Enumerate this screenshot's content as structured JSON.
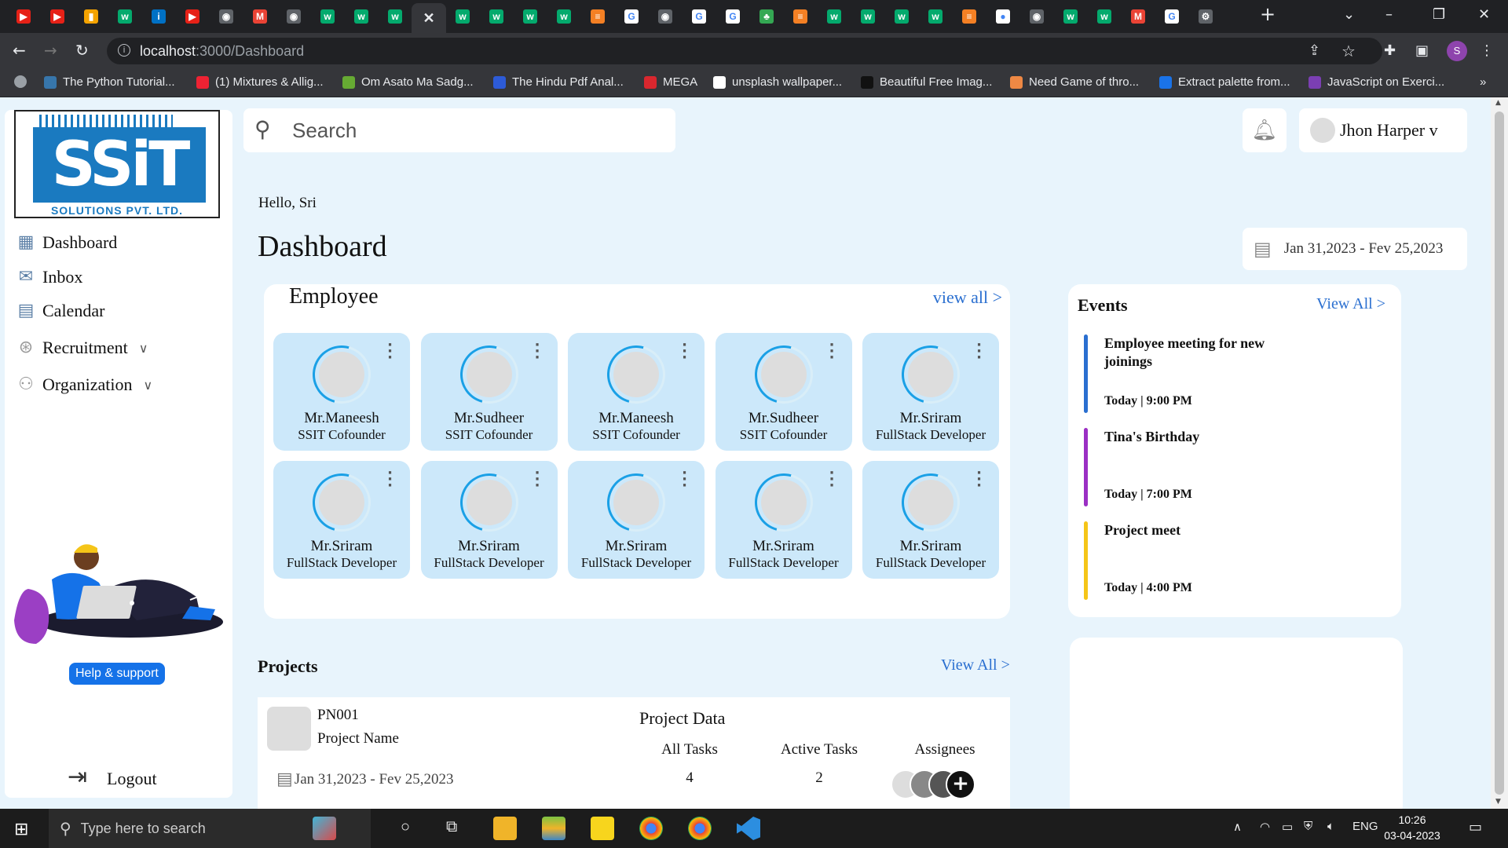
{
  "browser": {
    "url_host": "localhost",
    "url_path": ":3000/Dashboard",
    "profile_initial": "S",
    "bookmarks": [
      {
        "label": "The Python Tutorial...",
        "color": "#3776ab"
      },
      {
        "label": "(1) Mixtures & Allig...",
        "color": "#e23"
      },
      {
        "label": "Om Asato Ma Sadg...",
        "color": "#6a3"
      },
      {
        "label": "The Hindu Pdf Anal...",
        "color": "#2d5bd7"
      },
      {
        "label": "MEGA",
        "color": "#d9272e"
      },
      {
        "label": "unsplash wallpaper...",
        "color": "#fff"
      },
      {
        "label": "Beautiful Free Imag...",
        "color": "#111"
      },
      {
        "label": "Need Game of thro...",
        "color": "#e84"
      },
      {
        "label": "Extract palette from...",
        "color": "#1a73e8"
      },
      {
        "label": "JavaScript on Exerci...",
        "color": "#7b3fb3"
      }
    ],
    "bookmarks_more": "»"
  },
  "sidebar": {
    "logo_text": "SSiT",
    "logo_sub": "SOLUTIONS PVT. LTD.",
    "nav": [
      {
        "label": "Dashboard",
        "icon": "grid-icon"
      },
      {
        "label": "Inbox",
        "icon": "mail-icon"
      },
      {
        "label": "Calendar",
        "icon": "calendar-icon"
      },
      {
        "label": "Recruitment",
        "icon": "recruit-icon"
      },
      {
        "label": "Organization",
        "icon": "org-chart-icon"
      }
    ],
    "help_label": "Help & support",
    "logout_label": "Logout"
  },
  "header": {
    "search_placeholder": "Search",
    "user_name": "Jhon Harper v"
  },
  "main": {
    "greeting": "Hello, Sri",
    "title": "Dashboard",
    "date_range": "Jan 31,2023 - Fev 25,2023"
  },
  "employees": {
    "heading": "Employee",
    "view_all": "view all >",
    "cards": [
      {
        "name": "Mr.Maneesh",
        "role": "SSIT Cofounder"
      },
      {
        "name": "Mr.Sudheer",
        "role": "SSIT Cofounder"
      },
      {
        "name": "Mr.Maneesh",
        "role": "SSIT Cofounder"
      },
      {
        "name": "Mr.Sudheer",
        "role": "SSIT Cofounder"
      },
      {
        "name": "Mr.Sriram",
        "role": "FullStack Developer"
      },
      {
        "name": "Mr.Sriram",
        "role": "FullStack Developer"
      },
      {
        "name": "Mr.Sriram",
        "role": "FullStack Developer"
      },
      {
        "name": "Mr.Sriram",
        "role": "FullStack Developer"
      },
      {
        "name": "Mr.Sriram",
        "role": "FullStack Developer"
      },
      {
        "name": "Mr.Sriram",
        "role": "FullStack Developer"
      }
    ]
  },
  "events": {
    "heading": "Events",
    "view_all": "View All >",
    "items": [
      {
        "title": "Employee meeting for new joinings",
        "time": "Today | 9:00 PM",
        "color": "#2a6fd0"
      },
      {
        "title": "Tina's Birthday",
        "time": "Today | 7:00 PM",
        "color": "#9b2fc4"
      },
      {
        "title": "Project meet",
        "time": "Today | 4:00 PM",
        "color": "#f5c518"
      }
    ]
  },
  "projects": {
    "heading": "Projects",
    "view_all": "View All >",
    "item": {
      "code": "PN001",
      "name": "Project Name",
      "date_range": "Jan 31,2023 - Fev 25,2023",
      "data_heading": "Project Data",
      "all_tasks_label": "All Tasks",
      "all_tasks": "4",
      "active_tasks_label": "Active Tasks",
      "active_tasks": "2",
      "assignees_label": "Assignees",
      "add_assignee": "+"
    }
  },
  "taskbar": {
    "search_placeholder": "Type here to search",
    "lang": "ENG",
    "time": "10:26",
    "date": "03-04-2023"
  }
}
